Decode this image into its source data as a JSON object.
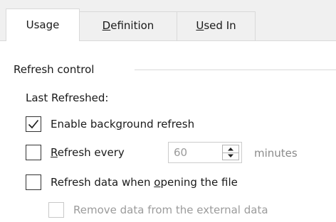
{
  "tabs": [
    {
      "label_pre": "Usa",
      "label_u": "g",
      "label_post": "e",
      "active": true
    },
    {
      "label_pre": "",
      "label_u": "D",
      "label_post": "efinition",
      "active": false
    },
    {
      "label_pre": "",
      "label_u": "U",
      "label_post": "sed In",
      "active": false
    }
  ],
  "refresh_control": {
    "group_label": "Refresh control",
    "last_refreshed": "Last Refreshed:",
    "background_refresh": {
      "pre": "Enable back",
      "u": "g",
      "post": "round refresh",
      "checked": true
    },
    "refresh_every": {
      "pre": "",
      "u": "R",
      "post": "efresh every",
      "checked": false,
      "value": "60",
      "unit": "minutes"
    },
    "refresh_on_open": {
      "pre": "Refresh data when ",
      "u": "o",
      "post": "pening the file",
      "checked": false
    },
    "remove_data": {
      "label": "Remove data from the external data",
      "checked": false,
      "enabled": false
    }
  },
  "icons": {
    "checkmark": "check-icon",
    "spin_up": "arrow-up-icon",
    "spin_down": "arrow-down-icon"
  }
}
